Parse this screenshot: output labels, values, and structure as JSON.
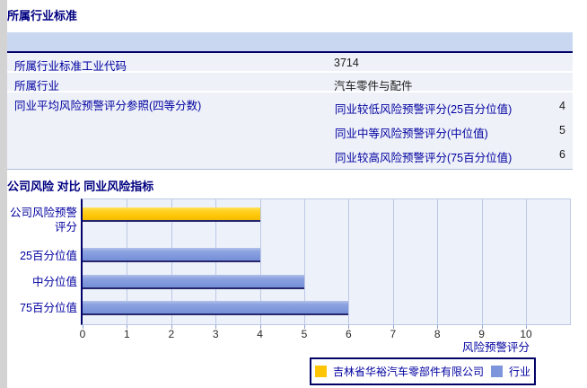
{
  "colors": {
    "title_text": "#000080",
    "label_text": "#0000a0",
    "value_text": "#1a1a1a",
    "header_band_bg": "#c9d8f0",
    "row_bg": "#eef1f8",
    "plot_bg": "#edf1f9",
    "gridline": "#bcc8e6",
    "company_bar": "#fdc504",
    "industry_bar": "#7d96db",
    "left_strip": "#d3d3d3"
  },
  "section_industry": {
    "title": "所属行业标准",
    "rows": [
      {
        "label": "所属行业标准工业代码",
        "value": "3714"
      },
      {
        "label": "所属行业",
        "value": "汽车零件与配件"
      }
    ],
    "peer_row": {
      "label": "同业平均风险预警评分参照(四等分数)",
      "items": [
        {
          "label": "同业较低风险预警评分(25百分位值)",
          "value": "4"
        },
        {
          "label": "同业中等风险预警评分(中位值)",
          "value": "5"
        },
        {
          "label": "同业较高风险预警评分(75百分位值)",
          "value": "6"
        }
      ]
    }
  },
  "section_chart": {
    "title": "公司风险 对比 同业风险指标"
  },
  "chart_data": {
    "type": "bar",
    "orientation": "horizontal",
    "title": "公司风险 对比 同业风险指标",
    "categories": [
      "公司风险预警评分",
      "25百分位值",
      "中分位值",
      "75百分位值"
    ],
    "values": [
      4,
      4,
      5,
      6
    ],
    "bar_colors": [
      "#fdc504",
      "#7d96db",
      "#7d96db",
      "#7d96db"
    ],
    "xlabel": "风险预警评分",
    "xlim": [
      0,
      11
    ],
    "ticks": [
      "0",
      "1",
      "2",
      "3",
      "4",
      "5",
      "6",
      "7",
      "8",
      "9",
      "10"
    ],
    "grid": true,
    "legend_position": "bottom",
    "legend": [
      {
        "label": "吉林省华裕汽车零部件有限公司",
        "color": "#fdc504",
        "series": "company"
      },
      {
        "label": "行业",
        "color": "#7d96db",
        "series": "industry"
      }
    ]
  }
}
